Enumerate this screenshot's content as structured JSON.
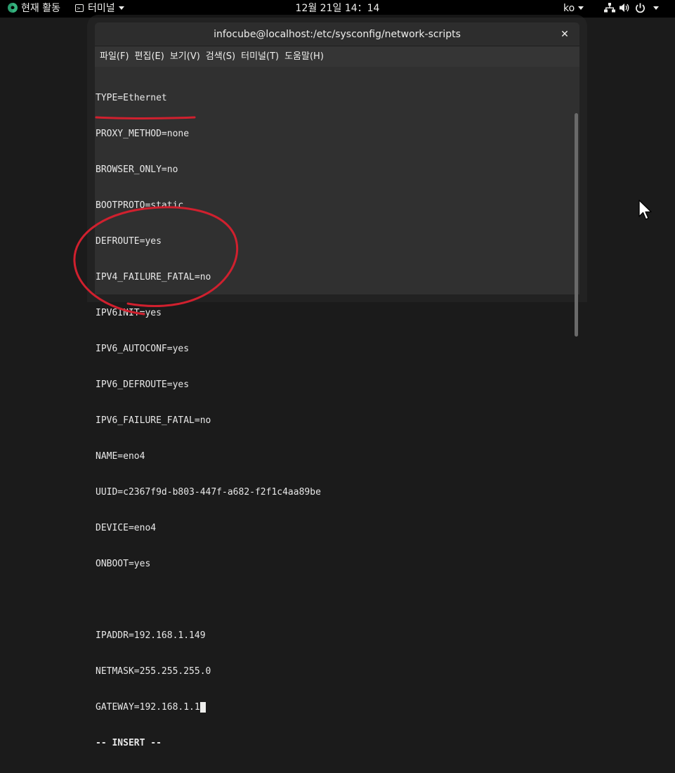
{
  "topbar": {
    "activities_label": "현재 활동",
    "app_menu_label": "터미널",
    "clock": "12월 21일  14：14",
    "lang": "ko",
    "icons": [
      "network-icon",
      "volume-icon",
      "power-icon",
      "chevron-down-icon"
    ]
  },
  "window": {
    "title": "infocube@localhost:/etc/sysconfig/network-scripts",
    "close_glyph": "✕",
    "menu": [
      "파일(F)",
      "편집(E)",
      "보기(V)",
      "검색(S)",
      "터미널(T)",
      "도움말(H)"
    ]
  },
  "terminal": {
    "lines": [
      "TYPE=Ethernet",
      "PROXY_METHOD=none",
      "BROWSER_ONLY=no",
      "BOOTPROTO=static",
      "DEFROUTE=yes",
      "IPV4_FAILURE_FATAL=no",
      "IPV6INIT=yes",
      "IPV6_AUTOCONF=yes",
      "IPV6_DEFROUTE=yes",
      "IPV6_FAILURE_FATAL=no",
      "NAME=eno4",
      "UUID=c2367f9d-b803-447f-a682-f2f1c4aa89be",
      "DEVICE=eno4",
      "ONBOOT=yes",
      "",
      "IPADDR=192.168.1.149",
      "NETMASK=255.255.255.0",
      "GATEWAY=192.168.1.1"
    ],
    "status": "-- INSERT --"
  },
  "colors": {
    "annotation": "#d0202e",
    "terminal_bg": "#303030",
    "terminal_fg": "#e8e8e8"
  }
}
